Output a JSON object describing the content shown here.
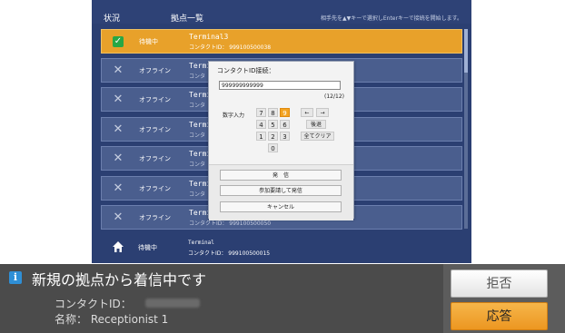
{
  "header": {
    "status_label": "状況",
    "list_label": "拠点一覧",
    "hint": "相手先を▲▼キーで選択しEnterキーで接続を開始します。"
  },
  "rows": [
    {
      "status": "待機中",
      "name": "Terminal3",
      "contact": "コンタクトID： 999100500038",
      "selected": true
    },
    {
      "status": "オフライン",
      "name": "Termi",
      "contact": "コンタ"
    },
    {
      "status": "オフライン",
      "name": "Termi",
      "contact": "コンタ"
    },
    {
      "status": "オフライン",
      "name": "Termi",
      "contact": "コンタ"
    },
    {
      "status": "オフライン",
      "name": "Termi",
      "contact": "コンタ"
    },
    {
      "status": "オフライン",
      "name": "Termi",
      "contact": "コンタ"
    },
    {
      "status": "オフライン",
      "name": "Termi",
      "contact": "コンタクトID： 999100500050"
    }
  ],
  "footer_row": {
    "status": "待機中",
    "name": "Terminal",
    "contact": "コンタクトID： 999100500015"
  },
  "dialog": {
    "title": "コンタクトID接続：",
    "input_value": "999999999999",
    "counter": "(12/12)",
    "numeric_label": "数字入力",
    "keys": [
      "7",
      "8",
      "9",
      "4",
      "5",
      "6",
      "1",
      "2",
      "3",
      "0"
    ],
    "active_key": "9",
    "arrow_left": "←",
    "arrow_right": "→",
    "backspace": "後退",
    "clear_all": "全てクリア",
    "call": "発　信",
    "call_after_join": "参加要請して発信",
    "cancel": "キャンセル"
  },
  "notification": {
    "title": "新規の拠点から着信中です",
    "contact_label": "コンタクトID：",
    "name_label": "名称： Receptionist 1",
    "reject": "拒否",
    "answer": "応答"
  },
  "colors": {
    "accent": "#e8a12a",
    "panel": "#2b3f72",
    "notify": "#4b4b4b",
    "info": "#2f8fd6"
  }
}
